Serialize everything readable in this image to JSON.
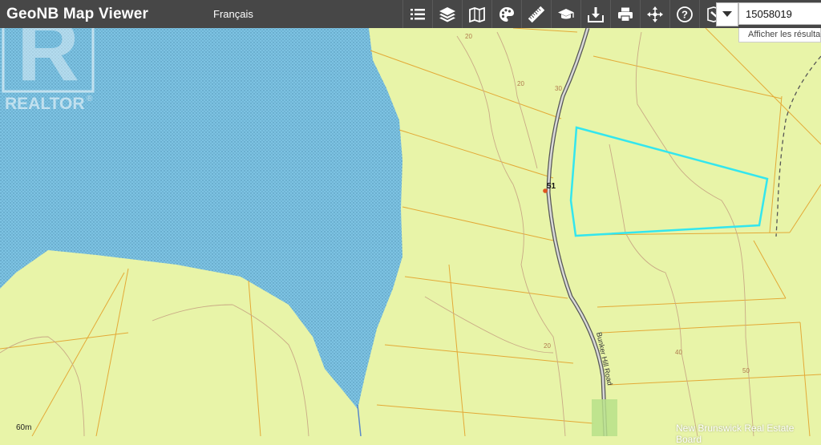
{
  "header": {
    "app_title": "GeoNB Map Viewer",
    "language_link": "Français"
  },
  "toolbar": {
    "tools": [
      {
        "icon": "list-icon"
      },
      {
        "icon": "layers-icon"
      },
      {
        "icon": "basemap-icon"
      },
      {
        "icon": "palette-icon"
      },
      {
        "icon": "ruler-icon"
      },
      {
        "icon": "education-icon"
      },
      {
        "icon": "download-icon"
      },
      {
        "icon": "print-icon"
      },
      {
        "icon": "share-icon"
      },
      {
        "icon": "help-icon"
      },
      {
        "icon": "clear-icon"
      }
    ]
  },
  "search": {
    "value": "15058019",
    "results_hint": "Afficher les résultats"
  },
  "realtor_logo": {
    "letter": "R",
    "text": "REALTOR",
    "mark": "®"
  },
  "map": {
    "route_number": "51",
    "road_name": "Bunker Hill Road",
    "contours": [
      "20",
      "20",
      "30",
      "20",
      "40",
      "50"
    ],
    "parcel_highlight_color": "#33e6ee",
    "water_color": "#7dc3e3",
    "land_color": "#e8f4a8"
  },
  "scale_text": "60m",
  "watermark": "New Brunswick Real Estate Board"
}
